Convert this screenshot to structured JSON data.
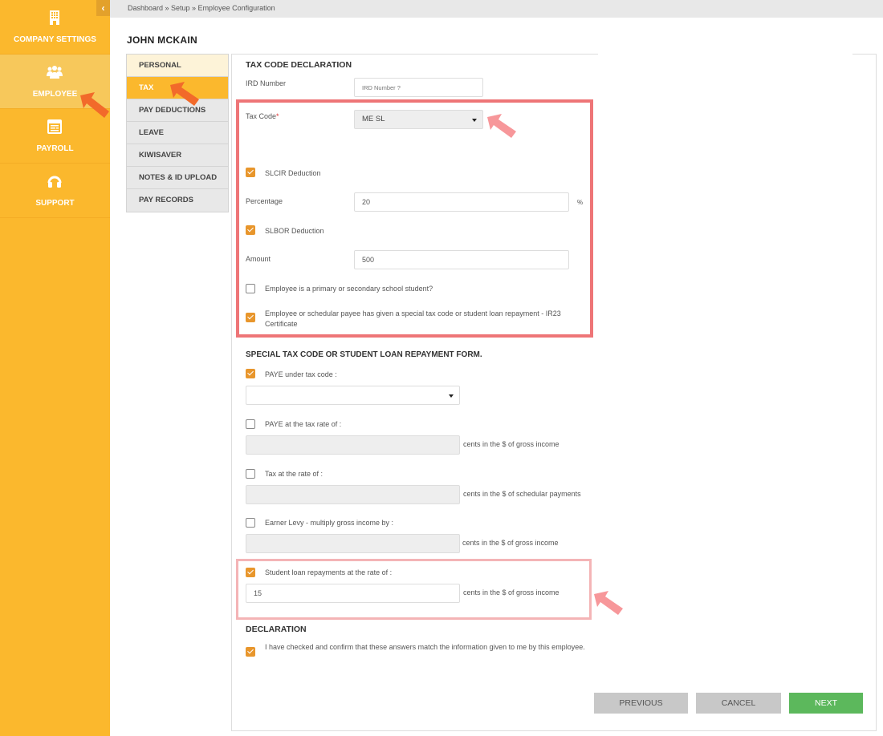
{
  "sidebar": {
    "collapse_icon": "chevron-left-icon",
    "collapse_glyph": "‹",
    "items": [
      {
        "label": "COMPANY SETTINGS",
        "icon": "building-icon",
        "active": false
      },
      {
        "label": "EMPLOYEE",
        "icon": "users-icon",
        "active": true
      },
      {
        "label": "PAYROLL",
        "icon": "payroll-icon",
        "active": false
      },
      {
        "label": "SUPPORT",
        "icon": "headset-icon",
        "active": false
      }
    ]
  },
  "breadcrumb": "Dashboard » Setup » Employee Configuration",
  "employee_name": "JOHN  MCKAIN",
  "tabs": [
    {
      "label": "PERSONAL"
    },
    {
      "label": "TAX",
      "active": true
    },
    {
      "label": "PAY DEDUCTIONS"
    },
    {
      "label": "LEAVE"
    },
    {
      "label": "KIWISAVER"
    },
    {
      "label": "NOTES & ID UPLOAD"
    },
    {
      "label": "PAY RECORDS"
    }
  ],
  "tax_code_declaration": {
    "title": "TAX CODE DECLARATION",
    "ird_label": "IRD Number",
    "ird_placeholder": "IRD Number ?",
    "tax_code_label": "Tax Code",
    "tax_code_required": "*",
    "tax_code_value": "ME SL",
    "slcir_label": "SLCIR Deduction",
    "slcir_checked": true,
    "percentage_label": "Percentage",
    "percentage_value": "20",
    "percentage_suffix": "%",
    "slbor_label": "SLBOR Deduction",
    "slbor_checked": true,
    "amount_label": "Amount",
    "amount_value": "500",
    "student_label": "Employee is a primary or secondary school student?",
    "student_checked": false,
    "ir23_label": "Employee or schedular payee has given a special tax code or student loan repayment - IR23 Certificate",
    "ir23_checked": true
  },
  "special_form": {
    "title": "SPECIAL TAX CODE OR STUDENT LOAN REPAYMENT FORM.",
    "paye_under_label": "PAYE under tax code :",
    "paye_under_checked": true,
    "paye_under_value": "",
    "paye_rate_label": "PAYE at the tax rate of :",
    "paye_rate_checked": false,
    "paye_rate_value": "",
    "paye_rate_suffix": "cents in the $ of gross income",
    "tax_rate_label": "Tax at the rate of :",
    "tax_rate_checked": false,
    "tax_rate_value": "",
    "tax_rate_suffix": "cents in the $ of schedular payments",
    "earner_levy_label": "Earner Levy - multiply gross income by :",
    "earner_levy_checked": false,
    "earner_levy_value": "",
    "earner_levy_suffix": "cents in the $ of gross income",
    "student_loan_label": "Student loan repayments at the rate of :",
    "student_loan_checked": true,
    "student_loan_value": "15",
    "student_loan_suffix": "cents in the $ of gross income"
  },
  "declaration": {
    "title": "DECLARATION",
    "confirm_label": "I have checked and confirm that these answers match the information given to me by this employee.",
    "confirm_checked": true
  },
  "buttons": {
    "previous": "PREVIOUS",
    "cancel": "CANCEL",
    "next": "NEXT"
  },
  "colors": {
    "sidebar": "#fbb82d",
    "accent_checkbox": "#e8962c",
    "highlight": "#ee7577",
    "next_button": "#5cb85c"
  }
}
